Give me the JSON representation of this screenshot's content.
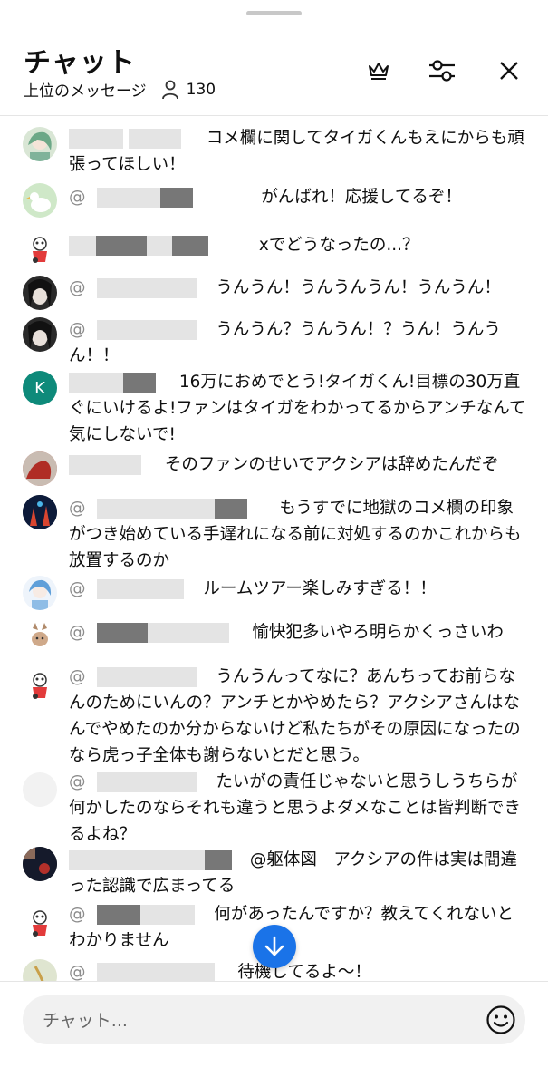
{
  "header": {
    "title": "チャット",
    "mode_label": "上位のメッセージ",
    "viewer_count": "130"
  },
  "icons": {
    "crown": "crown-icon",
    "filter": "sliders-icon",
    "close": "close-icon",
    "viewers": "person-icon",
    "emoji": "smiley-icon",
    "scroll_down": "arrow-down-icon"
  },
  "colors": {
    "accent": "#1a73e8",
    "author_gray": "#8c8c8c",
    "avatar_k": "#0e8a7a"
  },
  "messages": [
    {
      "author": "",
      "text": "コメ欄に関してタイガくんもえにからも頑張ってほしい！"
    },
    {
      "author": "@",
      "text": "がんばれ！応援してるぞ！"
    },
    {
      "author": "",
      "text": "xでどうなったの...？"
    },
    {
      "author": "@",
      "text": "うんうん！うんうんうん！うんうん！"
    },
    {
      "author": "@",
      "text": "うんうん？うんうん！？うん！うんうん！！"
    },
    {
      "author": "",
      "text": "16万におめでとう!タイガくん!目標の30万直ぐにいけるよ!ファンはタイガをわかってるからアンチなんて気にしないで!"
    },
    {
      "author": "",
      "text": "そのファンのせいでアクシアは辞めたんだぞ"
    },
    {
      "author": "@",
      "text": "もうすでに地獄のコメ欄の印象がつき始めている手遅れになる前に対処するのかこれからも放置するのか"
    },
    {
      "author": "@",
      "text": "ルームツアー楽しみすぎる！！"
    },
    {
      "author": "@",
      "text": "愉快犯多いやろ明らかくっさいわ"
    },
    {
      "author": "@",
      "text": "うんうんってなに？あんちってお前らなんのためにいんの？アンチとかやめたら？アクシアさんはなんでやめたのか分からないけど私たちがその原因になったのなら虎っ子全体も謝らないとだと思う。"
    },
    {
      "author": "@",
      "text": "たいがの責任じゃないと思うしうちらが何かしたのならそれも違うと思うよダメなことは皆判断できるよね？"
    },
    {
      "author": "",
      "text": "@躯体図　アクシアの件は実は間違った認識で広まってる"
    },
    {
      "author": "@",
      "text": "何があったんですか？教えてくれないとわかりません"
    },
    {
      "author": "@",
      "text": "待機してるよ〜！"
    }
  ],
  "input": {
    "placeholder": "チャット..."
  },
  "avatars": {
    "k_letter": "K"
  }
}
